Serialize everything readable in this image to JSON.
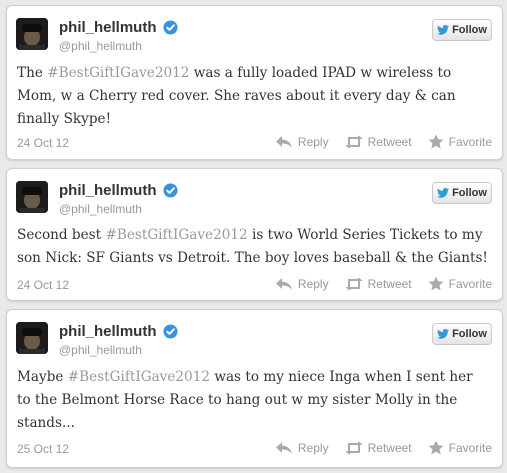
{
  "tweets": [
    {
      "display_name": "phil_hellmuth",
      "handle": "@phil_hellmuth",
      "follow_label": "Follow",
      "lines": [
        {
          "pre": "The ",
          "tag": "#BestGiftIGave2012",
          "post": " was a fully loaded IPAD w wireless to"
        },
        {
          "pre": "Mom, w a Cherry red cover. She raves about it every day & can",
          "tag": "",
          "post": ""
        },
        {
          "pre": "finally Skype!",
          "tag": "",
          "post": ""
        }
      ],
      "date": "24 Oct 12",
      "reply_label": "Reply",
      "retweet_label": "Retweet",
      "favorite_label": "Favorite"
    },
    {
      "display_name": "phil_hellmuth",
      "handle": "@phil_hellmuth",
      "follow_label": "Follow",
      "lines": [
        {
          "pre": "Second best ",
          "tag": "#BestGiftIGave2012",
          "post": " is two World Series Tickets to my"
        },
        {
          "pre": "son Nick: SF Giants vs Detroit. The boy loves baseball & the Giants!",
          "tag": "",
          "post": ""
        }
      ],
      "date": "24 Oct 12",
      "reply_label": "Reply",
      "retweet_label": "Retweet",
      "favorite_label": "Favorite"
    },
    {
      "display_name": "phil_hellmuth",
      "handle": "@phil_hellmuth",
      "follow_label": "Follow",
      "lines": [
        {
          "pre": "Maybe ",
          "tag": "#BestGiftIGave2012",
          "post": " was to my niece Inga when I sent her"
        },
        {
          "pre": "to the Belmont Horse Race to hang out w my sister Molly in the",
          "tag": "",
          "post": ""
        },
        {
          "pre": "stands...",
          "tag": "",
          "post": ""
        }
      ],
      "date": "25 Oct 12",
      "reply_label": "Reply",
      "retweet_label": "Retweet",
      "favorite_label": "Favorite"
    }
  ],
  "colors": {
    "verified": "#3b94d9",
    "twitter_bird": "#2e9ad8",
    "meta_gray": "#999999",
    "text": "#333333"
  },
  "icons": [
    "verified-badge-icon",
    "twitter-bird-icon",
    "reply-icon",
    "retweet-icon",
    "favorite-star-icon"
  ]
}
